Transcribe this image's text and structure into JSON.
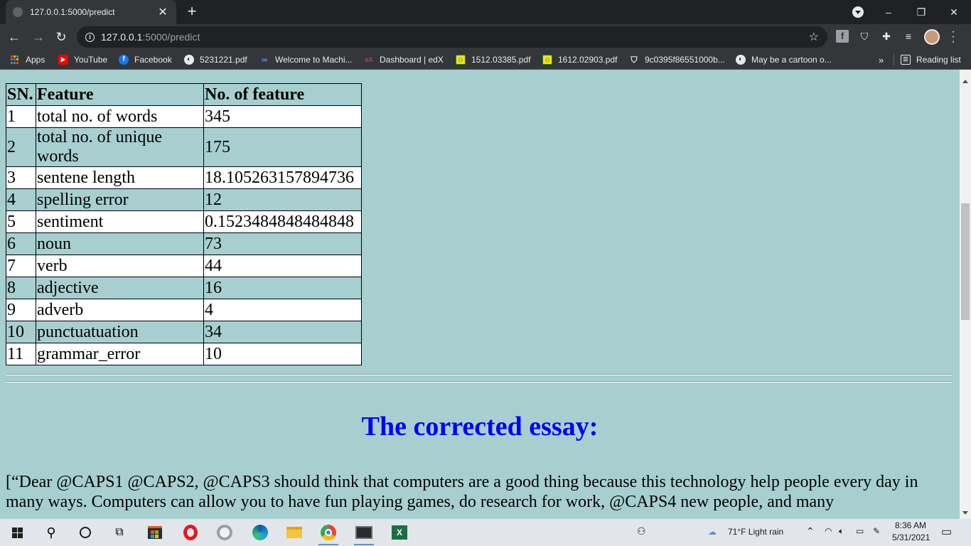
{
  "browser": {
    "tab_title": "127.0.0.1:5000/predict",
    "tab_close": "✕",
    "new_tab": "+",
    "url_host": "127.0.0.1",
    "url_path": ":5000/predict",
    "window_controls": {
      "minimize": "–",
      "restore": "❐",
      "close": "✕"
    },
    "bookmarks": [
      {
        "label": "Apps",
        "icon": "apps-grid-icon"
      },
      {
        "label": "YouTube",
        "icon": "youtube-icon"
      },
      {
        "label": "Facebook",
        "icon": "facebook-icon"
      },
      {
        "label": "5231221.pdf",
        "icon": "globe-icon"
      },
      {
        "label": "Welcome to Machi...",
        "icon": "coursera-icon"
      },
      {
        "label": "Dashboard | edX",
        "icon": "edx-icon"
      },
      {
        "label": "1512.03385.pdf",
        "icon": "smiley-icon"
      },
      {
        "label": "1612.02903.pdf",
        "icon": "smiley-icon"
      },
      {
        "label": "9c0395f86551000b...",
        "icon": "tag-icon"
      },
      {
        "label": "May be a cartoon o...",
        "icon": "globe-icon"
      }
    ],
    "more_bookmarks": "»",
    "reading_list": "Reading list"
  },
  "page": {
    "table": {
      "headers": [
        "SN.",
        "Feature",
        "No. of feature"
      ],
      "rows": [
        [
          "1",
          "total no. of words",
          "345"
        ],
        [
          "2",
          "total no. of unique words",
          "175"
        ],
        [
          "3",
          "sentene length",
          "18.105263157894736"
        ],
        [
          "4",
          "spelling error",
          "12"
        ],
        [
          "5",
          "sentiment",
          "0.1523484848484848"
        ],
        [
          "6",
          "noun",
          "73"
        ],
        [
          "7",
          "verb",
          "44"
        ],
        [
          "8",
          "adjective",
          "16"
        ],
        [
          "9",
          "adverb",
          "4"
        ],
        [
          "10",
          "punctuatuation",
          "34"
        ],
        [
          "11",
          "grammar_error",
          "10"
        ]
      ]
    },
    "essay_title": "The corrected essay:",
    "essay_text": "[“Dear @CAPS1 @CAPS2, @CAPS3 should think that computers are a good thing because this technology help people every day in many ways. Computers can allow you to have fun playing games, do research for work, @CAPS4 new people, and many"
  },
  "taskbar": {
    "weather": "71°F  Light rain",
    "time": "8:36 AM",
    "date": "5/31/2021"
  },
  "colors": {
    "page_bg": "#a7cfcf",
    "essay_title": "#0000ff",
    "chrome_dark": "#202124",
    "chrome_toolbar": "#35363a"
  }
}
